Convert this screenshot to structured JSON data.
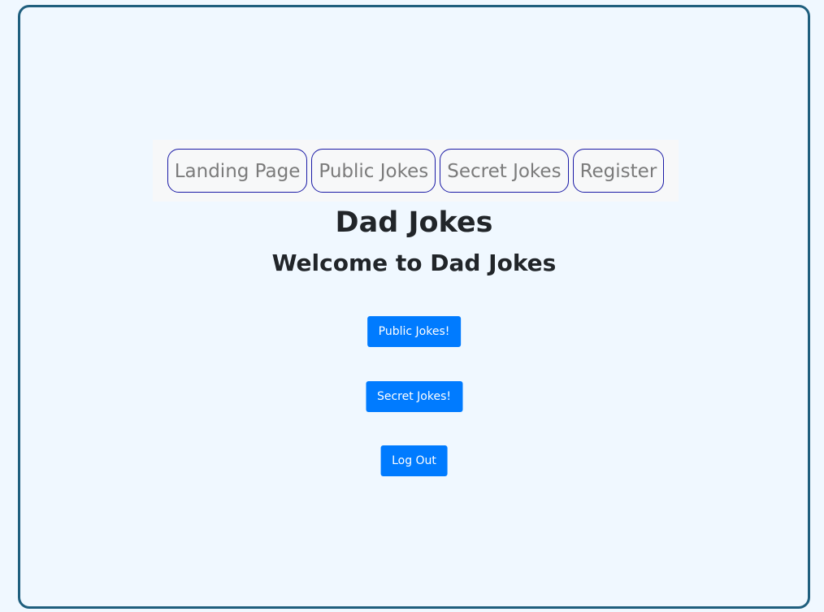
{
  "nav": {
    "items": [
      {
        "label": "Landing Page"
      },
      {
        "label": "Public Jokes"
      },
      {
        "label": "Secret Jokes"
      },
      {
        "label": "Register"
      }
    ]
  },
  "header": {
    "title": "Dad Jokes",
    "subtitle": "Welcome to Dad Jokes"
  },
  "actions": {
    "public_label": "Public Jokes!",
    "secret_label": "Secret Jokes!",
    "logout_label": "Log Out"
  },
  "colors": {
    "background": "#f0f8ff",
    "frame_border": "#1f5f7e",
    "primary_button": "#007bff",
    "nav_border": "#1a1aa6",
    "nav_text": "#7b7b7b",
    "heading_text": "#212529"
  }
}
